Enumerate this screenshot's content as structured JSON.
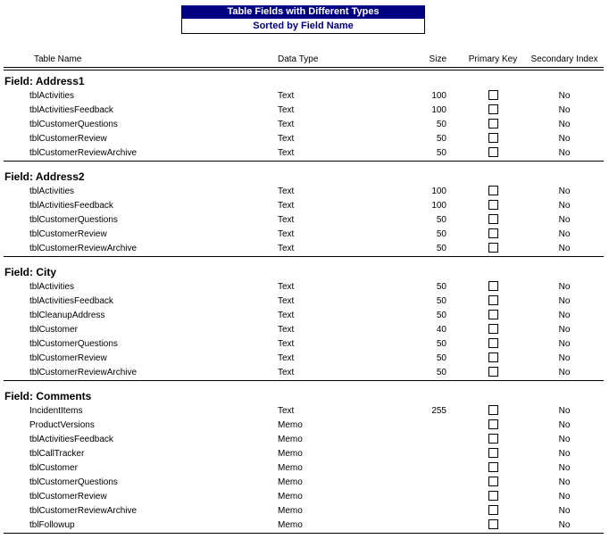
{
  "report": {
    "title": "Table Fields with Different Types",
    "subtitle": "Sorted by Field Name",
    "title_bg_color": "#000080",
    "subtitle_text_color": "#000080"
  },
  "columns": {
    "table_name": "Table Name",
    "data_type": "Data Type",
    "size": "Size",
    "primary_key": "Primary Key",
    "secondary_index": "Secondary Index"
  },
  "groups": [
    {
      "label": "Field: Address1",
      "field_name": "Address1",
      "rows": [
        {
          "table_name": "tblActivities",
          "data_type": "Text",
          "size": "100",
          "primary_key": false,
          "secondary_index": "No"
        },
        {
          "table_name": "tblActivitiesFeedback",
          "data_type": "Text",
          "size": "100",
          "primary_key": false,
          "secondary_index": "No"
        },
        {
          "table_name": "tblCustomerQuestions",
          "data_type": "Text",
          "size": "50",
          "primary_key": false,
          "secondary_index": "No"
        },
        {
          "table_name": "tblCustomerReview",
          "data_type": "Text",
          "size": "50",
          "primary_key": false,
          "secondary_index": "No"
        },
        {
          "table_name": "tblCustomerReviewArchive",
          "data_type": "Text",
          "size": "50",
          "primary_key": false,
          "secondary_index": "No"
        }
      ]
    },
    {
      "label": "Field: Address2",
      "field_name": "Address2",
      "rows": [
        {
          "table_name": "tblActivities",
          "data_type": "Text",
          "size": "100",
          "primary_key": false,
          "secondary_index": "No"
        },
        {
          "table_name": "tblActivitiesFeedback",
          "data_type": "Text",
          "size": "100",
          "primary_key": false,
          "secondary_index": "No"
        },
        {
          "table_name": "tblCustomerQuestions",
          "data_type": "Text",
          "size": "50",
          "primary_key": false,
          "secondary_index": "No"
        },
        {
          "table_name": "tblCustomerReview",
          "data_type": "Text",
          "size": "50",
          "primary_key": false,
          "secondary_index": "No"
        },
        {
          "table_name": "tblCustomerReviewArchive",
          "data_type": "Text",
          "size": "50",
          "primary_key": false,
          "secondary_index": "No"
        }
      ]
    },
    {
      "label": "Field: City",
      "field_name": "City",
      "rows": [
        {
          "table_name": "tblActivities",
          "data_type": "Text",
          "size": "50",
          "primary_key": false,
          "secondary_index": "No"
        },
        {
          "table_name": "tblActivitiesFeedback",
          "data_type": "Text",
          "size": "50",
          "primary_key": false,
          "secondary_index": "No"
        },
        {
          "table_name": "tblCleanupAddress",
          "data_type": "Text",
          "size": "50",
          "primary_key": false,
          "secondary_index": "No"
        },
        {
          "table_name": "tblCustomer",
          "data_type": "Text",
          "size": "40",
          "primary_key": false,
          "secondary_index": "No"
        },
        {
          "table_name": "tblCustomerQuestions",
          "data_type": "Text",
          "size": "50",
          "primary_key": false,
          "secondary_index": "No"
        },
        {
          "table_name": "tblCustomerReview",
          "data_type": "Text",
          "size": "50",
          "primary_key": false,
          "secondary_index": "No"
        },
        {
          "table_name": "tblCustomerReviewArchive",
          "data_type": "Text",
          "size": "50",
          "primary_key": false,
          "secondary_index": "No"
        }
      ]
    },
    {
      "label": "Field: Comments",
      "field_name": "Comments",
      "rows": [
        {
          "table_name": "IncidentItems",
          "data_type": "Text",
          "size": "255",
          "primary_key": false,
          "secondary_index": "No"
        },
        {
          "table_name": "ProductVersions",
          "data_type": "Memo",
          "size": "",
          "primary_key": false,
          "secondary_index": "No"
        },
        {
          "table_name": "tblActivitiesFeedback",
          "data_type": "Memo",
          "size": "",
          "primary_key": false,
          "secondary_index": "No"
        },
        {
          "table_name": "tblCallTracker",
          "data_type": "Memo",
          "size": "",
          "primary_key": false,
          "secondary_index": "No"
        },
        {
          "table_name": "tblCustomer",
          "data_type": "Memo",
          "size": "",
          "primary_key": false,
          "secondary_index": "No"
        },
        {
          "table_name": "tblCustomerQuestions",
          "data_type": "Memo",
          "size": "",
          "primary_key": false,
          "secondary_index": "No"
        },
        {
          "table_name": "tblCustomerReview",
          "data_type": "Memo",
          "size": "",
          "primary_key": false,
          "secondary_index": "No"
        },
        {
          "table_name": "tblCustomerReviewArchive",
          "data_type": "Memo",
          "size": "",
          "primary_key": false,
          "secondary_index": "No"
        },
        {
          "table_name": "tblFollowup",
          "data_type": "Memo",
          "size": "",
          "primary_key": false,
          "secondary_index": "No"
        }
      ]
    }
  ]
}
